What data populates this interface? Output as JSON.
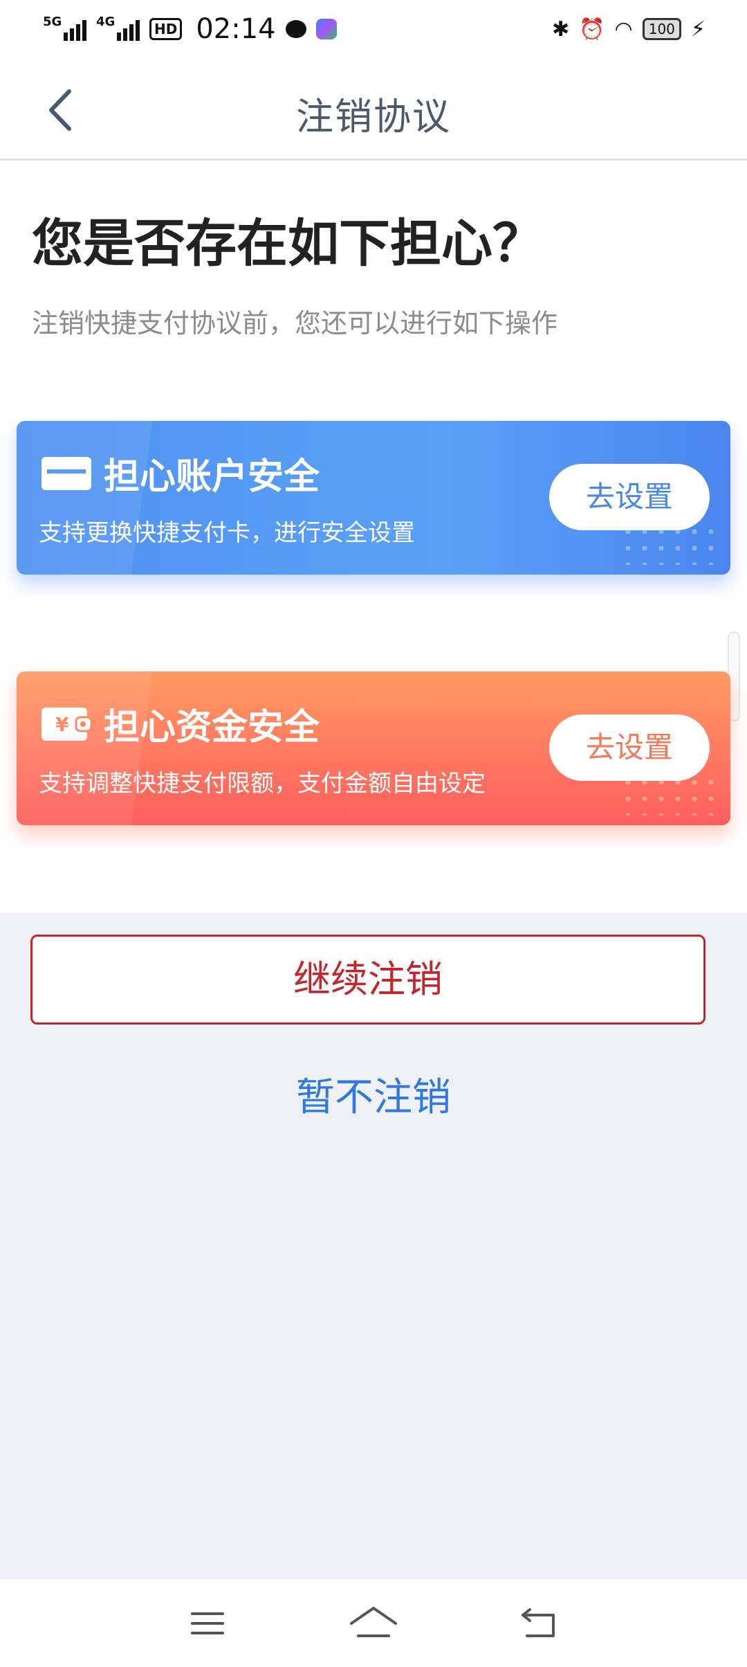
{
  "status_bar": {
    "network1": "5G",
    "network2": "4G",
    "hd": "HD",
    "time": "02:14",
    "battery": "100"
  },
  "header": {
    "title": "注销协议"
  },
  "content": {
    "heading": "您是否存在如下担心？",
    "subtext": "注销快捷支付协议前，您还可以进行如下操作"
  },
  "cards": [
    {
      "title": "担心账户安全",
      "desc": "支持更换快捷支付卡，进行安全设置",
      "button": "去设置",
      "icon": "card-icon",
      "color": "#4f92f0"
    },
    {
      "title": "担心资金安全",
      "desc": "支持调整快捷支付限额，支付金额自由设定",
      "button": "去设置",
      "icon": "wallet-icon",
      "color": "#ff7060"
    }
  ],
  "actions": {
    "continue_label": "继续注销",
    "cancel_label": "暂不注销",
    "continue_color": "#c0262c",
    "cancel_color": "#2f7ad9"
  }
}
